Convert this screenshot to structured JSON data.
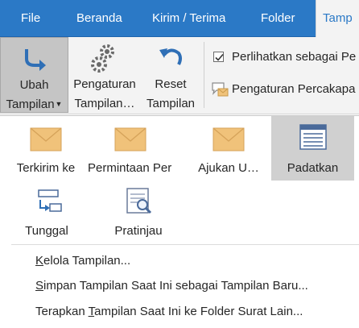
{
  "tabs": [
    {
      "label": "File"
    },
    {
      "label": "Beranda"
    },
    {
      "label": "Kirim / Terima"
    },
    {
      "label": "Folder"
    },
    {
      "label": "Tamp"
    }
  ],
  "ribbon": {
    "change_view": {
      "line1": "Ubah",
      "line2": "Tampilan",
      "icon": "change-view-icon"
    },
    "view_settings": {
      "line1": "Pengaturan",
      "line2": "Tampilan…",
      "icon": "gears-icon"
    },
    "reset_view": {
      "line1": "Reset",
      "line2": "Tampilan",
      "icon": "reset-arrow-icon"
    },
    "show_as_conversations": {
      "label": "Perlihatkan sebagai Pe",
      "checked": true
    },
    "conversation_settings": {
      "label": "Pengaturan Percakapa"
    }
  },
  "gallery": {
    "views": [
      {
        "label": "Terkirim ke",
        "icon": "envelope-icon",
        "selected": false
      },
      {
        "label": "Permintaan Per…",
        "icon": "envelope-icon",
        "selected": false
      },
      {
        "label": "Ajukan U…",
        "icon": "envelope-icon",
        "selected": false
      },
      {
        "label": "Padatkan",
        "icon": "compact-list-icon",
        "selected": true
      },
      {
        "label": "Tunggal",
        "icon": "single-list-icon",
        "selected": false
      },
      {
        "label": "Pratinjau",
        "icon": "preview-icon",
        "selected": false
      }
    ],
    "menu": [
      {
        "before": "",
        "key": "K",
        "after": "elola Tampilan..."
      },
      {
        "before": "",
        "key": "S",
        "after": "impan Tampilan Saat Ini sebagai Tampilan Baru..."
      },
      {
        "before": "Terapkan ",
        "key": "T",
        "after": "ampilan Saat Ini ke Folder Surat Lain..."
      }
    ]
  },
  "colors": {
    "accent": "#2b79c6",
    "ribbon_bg": "#f3f3f3",
    "selected_bg": "#d0d0d0",
    "envelope": "#f0c27a"
  }
}
